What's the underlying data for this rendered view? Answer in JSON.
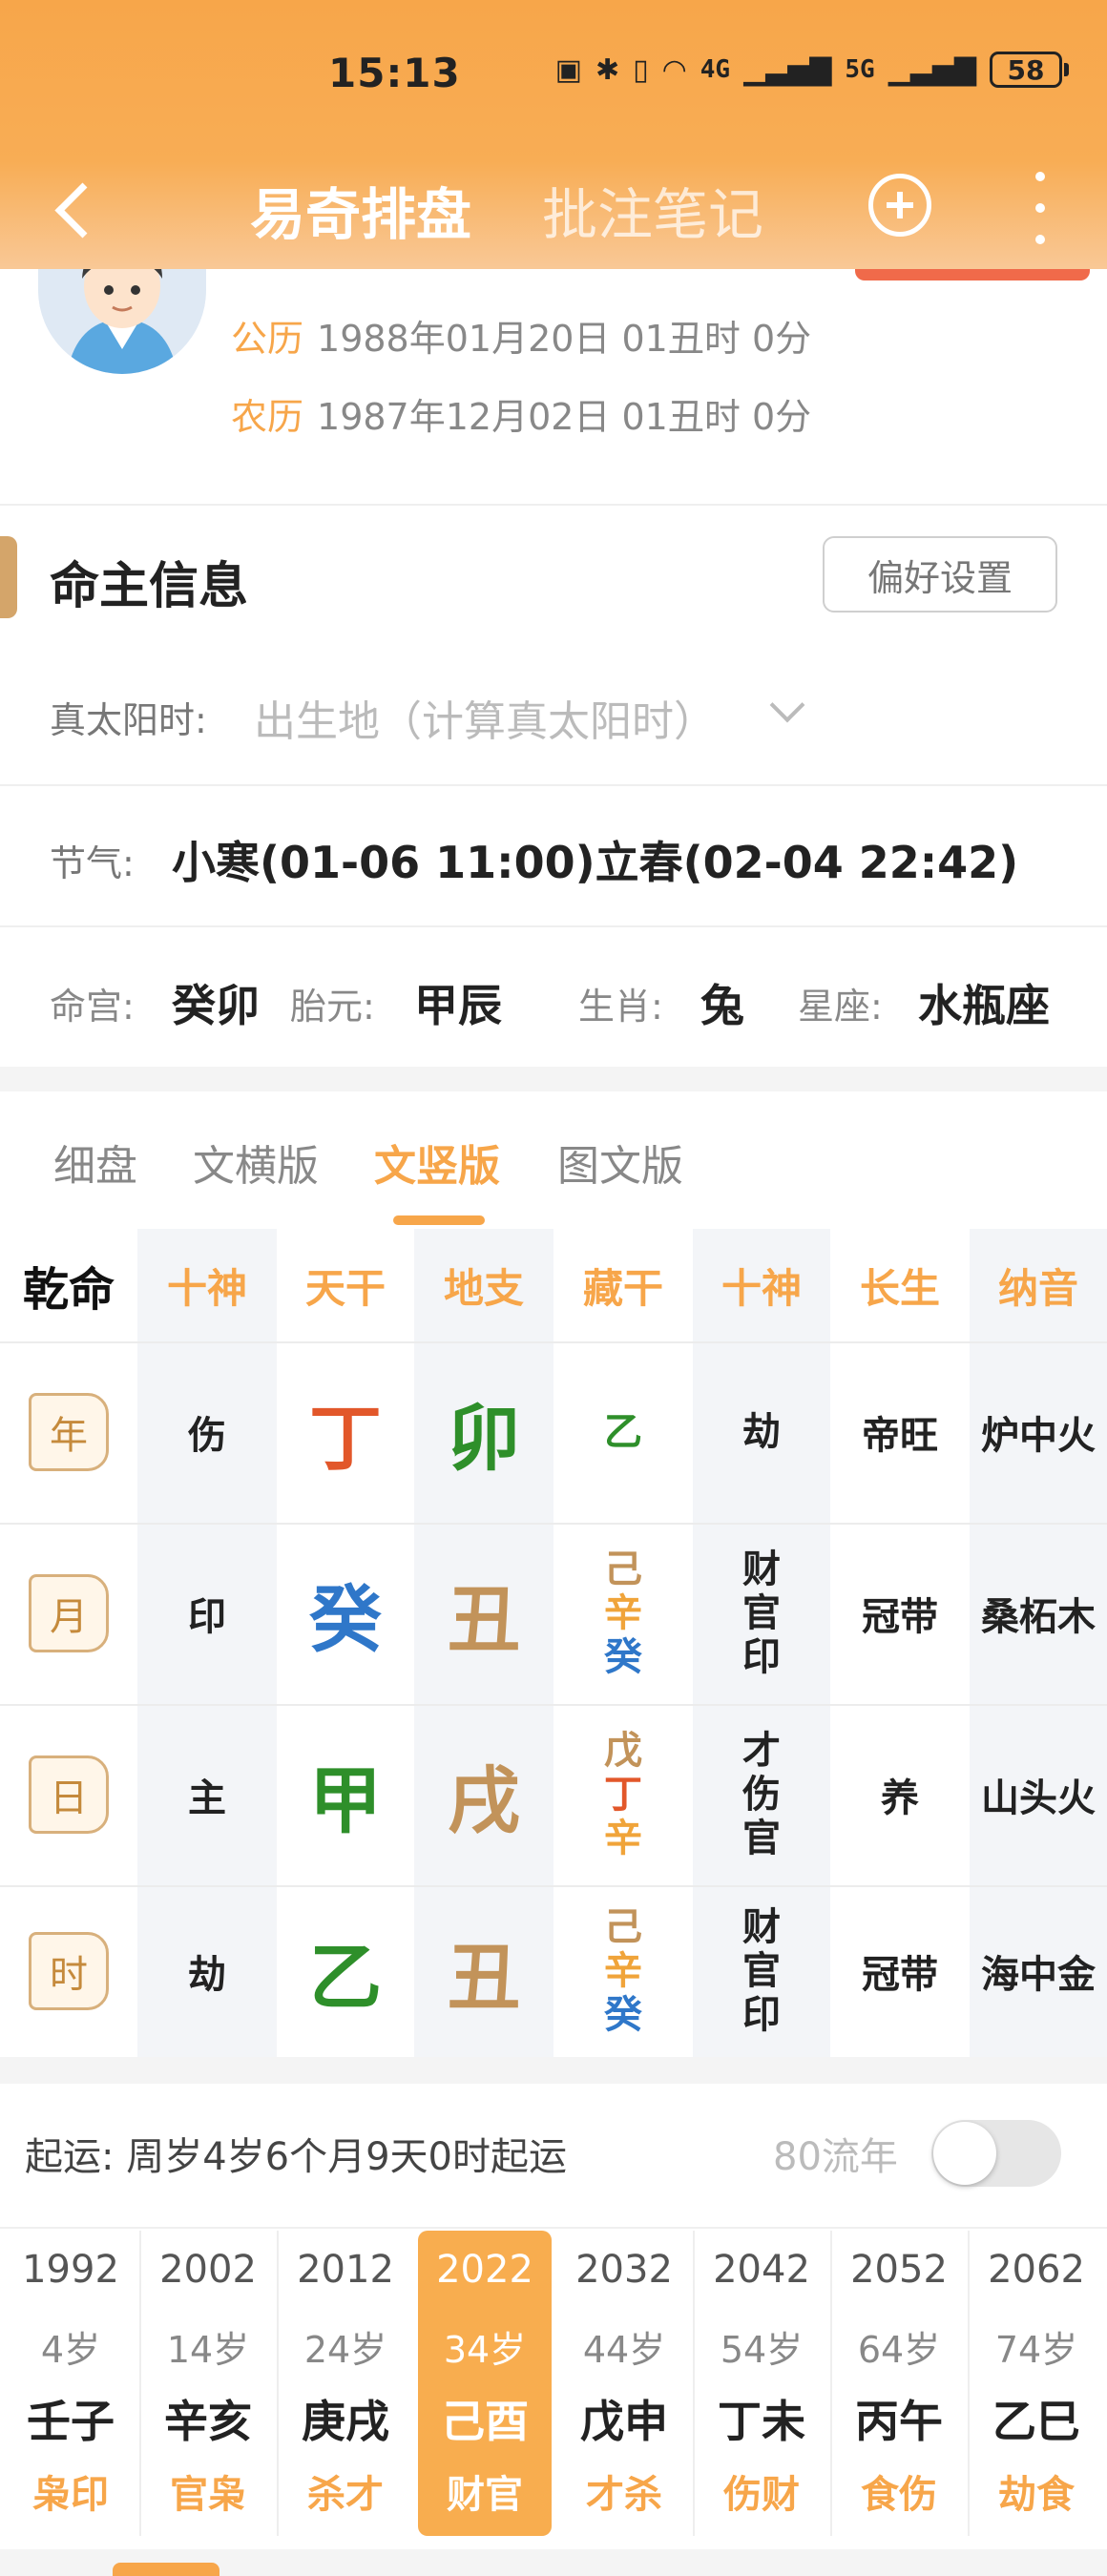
{
  "status_bar": {
    "time": "15:13",
    "signal_4g": "4G",
    "signal_5g": "5G",
    "battery": "58"
  },
  "nav": {
    "title": "易奇排盘",
    "notes_tab": "批注笔记"
  },
  "profile": {
    "solar_label": "公历",
    "solar_date": "1988年01月20日 01丑时 0分",
    "lunar_label": "农历",
    "lunar_date": "1987年12月02日 01丑时 0分"
  },
  "section": {
    "title": "命主信息",
    "pref_button": "偏好设置"
  },
  "solar_time": {
    "label": "真太阳时:",
    "placeholder": "出生地（计算真太阳时）"
  },
  "jieqi": {
    "label": "节气:",
    "value": "小寒(01-06 11:00)立春(02-04 22:42)"
  },
  "palace": {
    "minggong_label": "命宫:",
    "minggong": "癸卯",
    "taiyuan_label": "胎元:",
    "taiyuan": "甲辰",
    "zodiac_label": "生肖:",
    "zodiac": "兔",
    "constellation_label": "星座:",
    "constellation": "水瓶座"
  },
  "tabs": [
    "细盘",
    "文横版",
    "文竖版",
    "图文版"
  ],
  "active_tab": 2,
  "table": {
    "gender": "乾命",
    "headers": [
      "十神",
      "天干",
      "地支",
      "藏干",
      "十神",
      "长生",
      "纳音"
    ],
    "rows": [
      {
        "tag": "年",
        "shishen": "伤",
        "stem": "丁",
        "branch": "卯",
        "hidden": [
          "乙"
        ],
        "tengods": [
          "劫"
        ],
        "changsheng": "帝旺",
        "nayin": "炉中火"
      },
      {
        "tag": "月",
        "shishen": "印",
        "stem": "癸",
        "branch": "丑",
        "hidden": [
          "己",
          "辛",
          "癸"
        ],
        "tengods": [
          "财",
          "官",
          "印"
        ],
        "changsheng": "冠带",
        "nayin": "桑柘木"
      },
      {
        "tag": "日",
        "shishen": "主",
        "stem": "甲",
        "branch": "戌",
        "hidden": [
          "戊",
          "丁",
          "辛"
        ],
        "tengods": [
          "才",
          "伤",
          "官"
        ],
        "changsheng": "养",
        "nayin": "山头火"
      },
      {
        "tag": "时",
        "shishen": "劫",
        "stem": "乙",
        "branch": "丑",
        "hidden": [
          "己",
          "辛",
          "癸"
        ],
        "tengods": [
          "财",
          "官",
          "印"
        ],
        "changsheng": "冠带",
        "nayin": "海中金"
      }
    ]
  },
  "colors": {
    "accent": "#f7a64a",
    "fire": "#e2572a",
    "water": "#2f77c9",
    "wood": "#2e8f2a",
    "earth": "#c2935a",
    "metal": "#f0a43a"
  },
  "luck": {
    "label": "起运:",
    "value": "周岁4岁6个月9天0时起运",
    "toggle_label": "80流年",
    "columns": [
      {
        "year": "1992",
        "age": "4岁",
        "ganzhi": "壬子",
        "shishen": "枭印"
      },
      {
        "year": "2002",
        "age": "14岁",
        "ganzhi": "辛亥",
        "shishen": "官枭"
      },
      {
        "year": "2012",
        "age": "24岁",
        "ganzhi": "庚戌",
        "shishen": "杀才"
      },
      {
        "year": "2022",
        "age": "34岁",
        "ganzhi": "己酉",
        "shishen": "财官"
      },
      {
        "year": "2032",
        "age": "44岁",
        "ganzhi": "戊申",
        "shishen": "才杀"
      },
      {
        "year": "2042",
        "age": "54岁",
        "ganzhi": "丁未",
        "shishen": "伤财"
      },
      {
        "year": "2052",
        "age": "64岁",
        "ganzhi": "丙午",
        "shishen": "食伤"
      },
      {
        "year": "2062",
        "age": "74岁",
        "ganzhi": "乙巳",
        "shishen": "劫食"
      }
    ],
    "active_index": 3
  }
}
